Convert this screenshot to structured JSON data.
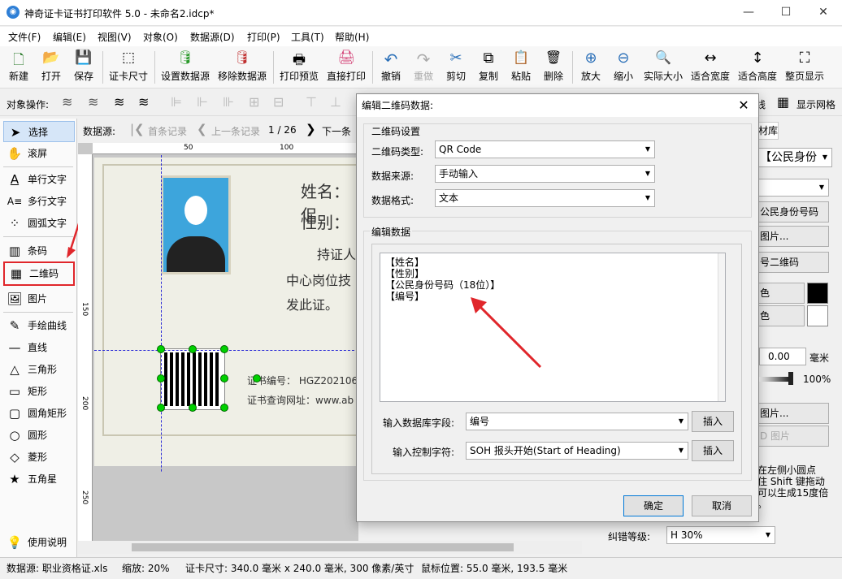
{
  "window": {
    "title": "神奇证卡证书打印软件 5.0 - 未命名2.idcp*",
    "min": "—",
    "max": "☐",
    "close": "✕"
  },
  "menus": [
    "文件(F)",
    "编辑(E)",
    "视图(V)",
    "对象(O)",
    "数据源(D)",
    "打印(P)",
    "工具(T)",
    "帮助(H)"
  ],
  "toolbar": [
    {
      "label": "新建",
      "icon": "new-file-icon",
      "glyph": "🗋"
    },
    {
      "label": "打开",
      "icon": "open-icon",
      "glyph": "📂"
    },
    {
      "label": "保存",
      "icon": "save-icon",
      "glyph": "💾"
    },
    {
      "label": "证卡尺寸",
      "icon": "card-size-icon",
      "glyph": "⬚"
    },
    {
      "label": "设置数据源",
      "icon": "set-datasource-icon",
      "glyph": "🛢"
    },
    {
      "label": "移除数据源",
      "icon": "remove-datasource-icon",
      "glyph": "🛢"
    },
    {
      "label": "打印预览",
      "icon": "print-preview-icon",
      "glyph": "🖶"
    },
    {
      "label": "直接打印",
      "icon": "print-icon",
      "glyph": "🖨"
    },
    {
      "label": "撤销",
      "icon": "undo-icon",
      "glyph": "↶"
    },
    {
      "label": "重做",
      "icon": "redo-icon",
      "glyph": "↷"
    },
    {
      "label": "剪切",
      "icon": "cut-icon",
      "glyph": "✂"
    },
    {
      "label": "复制",
      "icon": "copy-icon",
      "glyph": "⧉"
    },
    {
      "label": "粘贴",
      "icon": "paste-icon",
      "glyph": "📋"
    },
    {
      "label": "删除",
      "icon": "delete-icon",
      "glyph": "🗑"
    },
    {
      "label": "放大",
      "icon": "zoom-in-icon",
      "glyph": "⊕"
    },
    {
      "label": "缩小",
      "icon": "zoom-out-icon",
      "glyph": "⊖"
    },
    {
      "label": "实际大小",
      "icon": "actual-size-icon",
      "glyph": "🔍"
    },
    {
      "label": "适合宽度",
      "icon": "fit-width-icon",
      "glyph": "↔"
    },
    {
      "label": "适合高度",
      "icon": "fit-height-icon",
      "glyph": "↕"
    },
    {
      "label": "整页显示",
      "icon": "fit-page-icon",
      "glyph": "⛶"
    }
  ],
  "objbar": {
    "label": "对象操作:",
    "right_fragment": "线",
    "grid": "显示网格"
  },
  "tools": [
    {
      "label": "选择",
      "icon": "select-arrow-icon",
      "glyph": "➤"
    },
    {
      "label": "滚屏",
      "icon": "hand-icon",
      "glyph": "✋"
    },
    {
      "label": "单行文字",
      "icon": "single-line-text-icon",
      "glyph": "A"
    },
    {
      "label": "多行文字",
      "icon": "multiline-text-icon",
      "glyph": "A≡"
    },
    {
      "label": "圆弧文字",
      "icon": "arc-text-icon",
      "glyph": "⁘"
    },
    {
      "label": "条码",
      "icon": "barcode-icon",
      "glyph": "▥"
    },
    {
      "label": "二维码",
      "icon": "qrcode-icon",
      "glyph": "▦"
    },
    {
      "label": "图片",
      "icon": "image-icon",
      "glyph": "🖼"
    },
    {
      "label": "手绘曲线",
      "icon": "pen-icon",
      "glyph": "✎"
    },
    {
      "label": "直线",
      "icon": "line-icon",
      "glyph": "—"
    },
    {
      "label": "三角形",
      "icon": "triangle-icon",
      "glyph": "△"
    },
    {
      "label": "矩形",
      "icon": "rectangle-icon",
      "glyph": "▭"
    },
    {
      "label": "圆角矩形",
      "icon": "rounded-rect-icon",
      "glyph": "▢"
    },
    {
      "label": "圆形",
      "icon": "circle-icon",
      "glyph": "○"
    },
    {
      "label": "菱形",
      "icon": "diamond-icon",
      "glyph": "◇"
    },
    {
      "label": "五角星",
      "icon": "star-icon",
      "glyph": "★"
    },
    {
      "label": "使用说明",
      "icon": "help-bulb-icon",
      "glyph": "💡"
    }
  ],
  "datanav": {
    "label": "数据源:",
    "first": "首条记录",
    "prev": "上一条记录",
    "pos": "1 / 26",
    "next": "下一条"
  },
  "ruler": {
    "t50": "50",
    "t100": "100",
    "l150": "150",
    "l200": "200",
    "l250": "250"
  },
  "cert": {
    "name": "姓名：佀",
    "gender": "性别：",
    "holder": "持证人",
    "line1": "中心岗位技",
    "line2": "发此证。",
    "num": "证书编号：  HGZ202106",
    "url": "证书查询网址：www.ab"
  },
  "right": {
    "tab": "材库",
    "combo": "【公民身份",
    "btn1": "公民身份号码",
    "btn2": "图片...",
    "btn3": "号二维码",
    "color1": "色",
    "color2": "色",
    "num_value": "0.00",
    "num_unit": "毫米",
    "opacity": "100%",
    "img1": "图片...",
    "img2": "D 图片",
    "tip": "在左侧小圆点\n住 Shift 键拖动\n可以生成15度倍\n。",
    "ec_label": "纠错等级:",
    "ec_value": "H 30%"
  },
  "dialog": {
    "title": "编辑二维码数据:",
    "settings_group": "二维码设置",
    "type_label": "二维码类型:",
    "type_value": "QR Code",
    "source_label": "数据来源:",
    "source_value": "手动输入",
    "format_label": "数据格式:",
    "format_value": "文本",
    "edit_group": "编辑数据",
    "content": "【姓名】\n【性别】\n【公民身份号码（18位）】\n【编号】",
    "field_label": "输入数据库字段:",
    "field_value": "编号",
    "ctrl_label": "输入控制字符:",
    "ctrl_value": "SOH  报头开始(Start of Heading)",
    "insert": "插入",
    "ok": "确定",
    "cancel": "取消"
  },
  "status": {
    "source": "数据源: 职业资格证.xls",
    "zoom": "缩放: 20%",
    "size": "证卡尺寸: 340.0 毫米 x 240.0 毫米, 300 像素/英寸",
    "mouse": "鼠标位置: 55.0 毫米, 193.5 毫米"
  },
  "colors": {
    "accent": "#e0262b",
    "handle": "#00d000",
    "guide": "#2b2bd6"
  }
}
